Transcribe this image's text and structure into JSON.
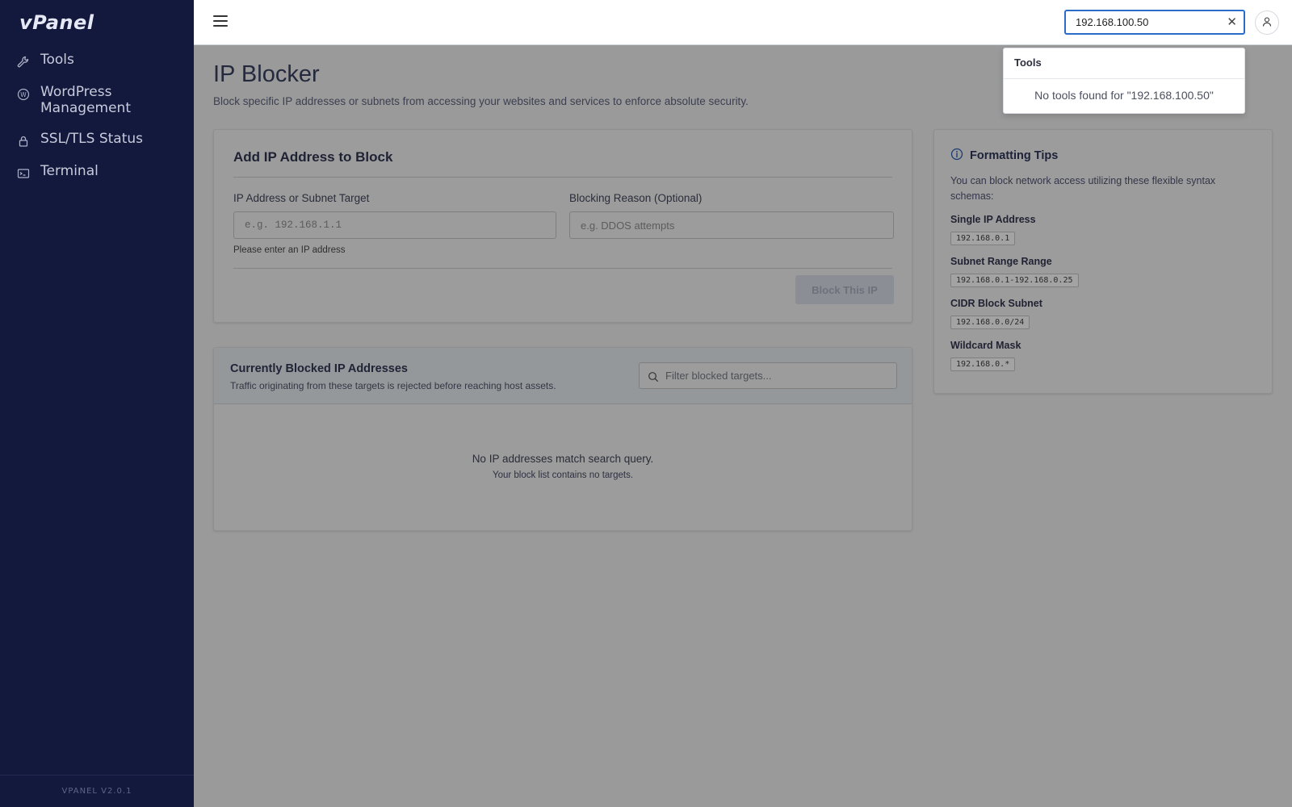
{
  "app": {
    "logo": "vPanel",
    "version": "VPANEL V2.0.1"
  },
  "sidebar": {
    "items": [
      {
        "label": "Tools",
        "icon": "wrench-icon"
      },
      {
        "label": "WordPress Management",
        "icon": "wordpress-icon"
      },
      {
        "label": "SSL/TLS Status",
        "icon": "lock-icon"
      },
      {
        "label": "Terminal",
        "icon": "terminal-icon"
      }
    ]
  },
  "topbar": {
    "search_value": "192.168.100.50",
    "clear_symbol": "✕"
  },
  "search_popup": {
    "header": "Tools",
    "message": "No tools found for \"192.168.100.50\""
  },
  "page": {
    "title": "IP Blocker",
    "description": "Block specific IP addresses or subnets from accessing your websites and services to enforce absolute security."
  },
  "add_form": {
    "title": "Add IP Address to Block",
    "ip_label": "IP Address or Subnet Target",
    "ip_placeholder": "e.g. 192.168.1.1",
    "ip_hint": "Please enter an IP address",
    "reason_label": "Blocking Reason (Optional)",
    "reason_placeholder": "e.g. DDOS attempts",
    "submit_label": "Block This IP"
  },
  "blocked_list": {
    "title": "Currently Blocked IP Addresses",
    "subtitle": "Traffic originating from these targets is rejected before reaching host assets.",
    "filter_placeholder": "Filter blocked targets...",
    "empty_title": "No IP addresses match search query.",
    "empty_subtitle": "Your block list contains no targets."
  },
  "tips": {
    "title": "Formatting Tips",
    "description": "You can block network access utilizing these flexible syntax schemas:",
    "items": [
      {
        "label": "Single IP Address",
        "example": "192.168.0.1"
      },
      {
        "label": "Subnet Range Range",
        "example": "192.168.0.1-192.168.0.25"
      },
      {
        "label": "CIDR Block Subnet",
        "example": "192.168.0.0/24"
      },
      {
        "label": "Wildcard Mask",
        "example": "192.168.0.*"
      }
    ]
  },
  "colors": {
    "sidebar_bg": "#13183d",
    "accent": "#2a6cc8",
    "overlay_bg": "#9a9a9a"
  }
}
